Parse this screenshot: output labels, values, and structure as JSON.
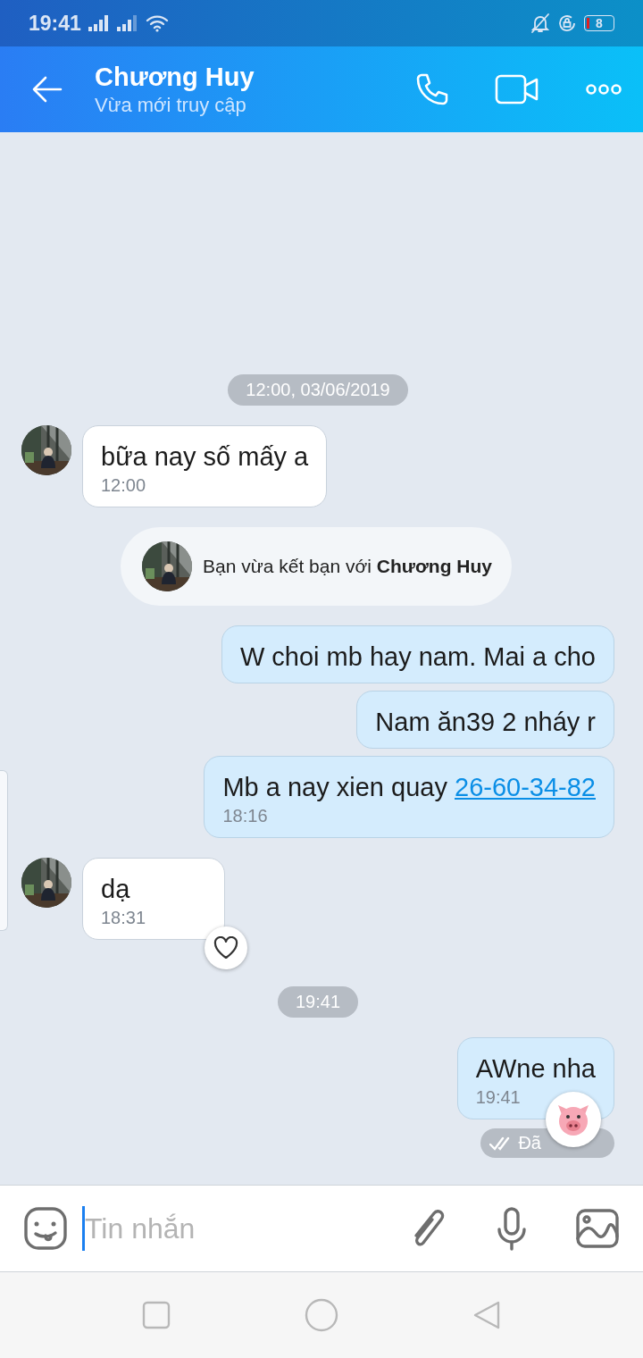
{
  "status_bar": {
    "time": "19:41",
    "battery": "8"
  },
  "header": {
    "name": "Chương Huy",
    "subtitle": "Vừa mới truy cập"
  },
  "messages": [
    {
      "kind": "date",
      "text": "12:00, 03/06/2019"
    },
    {
      "kind": "incoming",
      "text": "bữa nay số mấy a",
      "time": "12:00"
    },
    {
      "kind": "system",
      "text": "Bạn vừa kết bạn với **Chương Huy**"
    },
    {
      "kind": "outgoing",
      "text": "W choi mb hay nam. Mai a cho"
    },
    {
      "kind": "outgoing",
      "text": "Nam  ăn39 2 nháy r"
    },
    {
      "kind": "outgoing",
      "text": "Mb a nay xien quay ",
      "link": "26-60-34-82",
      "time": "18:16"
    },
    {
      "kind": "incoming",
      "text": "dạ",
      "time": "18:31",
      "reaction": {
        "kind": "heart"
      }
    },
    {
      "kind": "date",
      "text": "19:41"
    },
    {
      "kind": "outgoing",
      "text": "AWne nha",
      "time": "19:41",
      "reaction": {
        "kind": "pig"
      },
      "receipt": "Đã"
    }
  ],
  "composer": {
    "placeholder": "Tin nhắn"
  }
}
